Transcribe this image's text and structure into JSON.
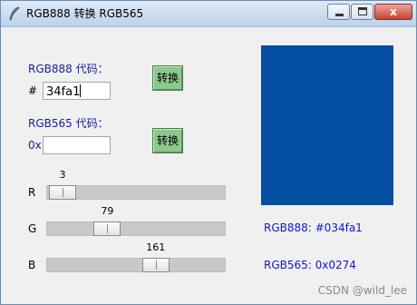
{
  "window": {
    "title": "RGB888 转换 RGB565",
    "close_glyph": "x"
  },
  "rgb888": {
    "label": "RGB888 代码：",
    "prefix": "#",
    "value": "34fa1",
    "button": "转换"
  },
  "rgb565": {
    "label": "RGB565 代码：",
    "prefix": "0x",
    "value": "",
    "button": "转换"
  },
  "sliders": [
    {
      "label": "R",
      "value": 3,
      "value_text": "3",
      "max": 255
    },
    {
      "label": "G",
      "value": 79,
      "value_text": "79",
      "max": 255
    },
    {
      "label": "B",
      "value": 161,
      "value_text": "161",
      "max": 255
    }
  ],
  "preview": {
    "color": "#034fa1"
  },
  "results": {
    "rgb888_text": "RGB888: #034fa1",
    "rgb565_text": "RGB565: 0x0274"
  },
  "watermark": "CSDN @wild_lee",
  "colors": {
    "accent_label": "#1c1c9c",
    "result_text": "#1414d6",
    "button_green": "#8cc98c"
  }
}
